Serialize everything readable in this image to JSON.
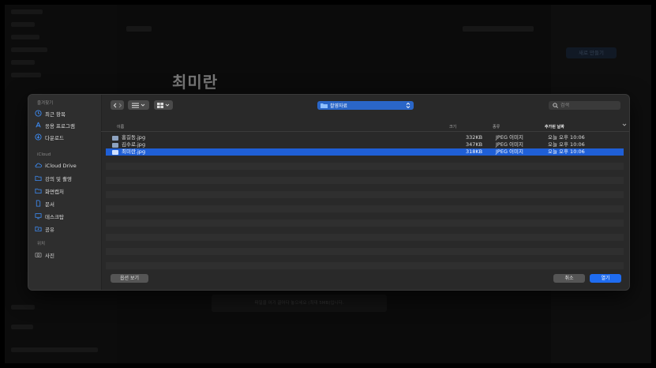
{
  "page": {
    "title": "최미란",
    "right_button": "새로 만들기",
    "upload_hint": "파일을 여기 끌어다 놓으세요 (최대 5MB)입니다.",
    "toolbar_right": [
      "공유"
    ]
  },
  "dialog": {
    "sidebar": {
      "favorites_label": "즐겨찾기",
      "favorites": [
        {
          "label": "최근 항목",
          "icon": "clock-icon"
        },
        {
          "label": "응용 프로그램",
          "icon": "apps-icon"
        },
        {
          "label": "다운로드",
          "icon": "download-icon"
        }
      ],
      "icloud_label": "iCloud",
      "icloud": [
        {
          "label": "iCloud Drive",
          "icon": "cloud-icon"
        },
        {
          "label": "강의 및 촬영",
          "icon": "folder-icon"
        },
        {
          "label": "화면캡처",
          "icon": "folder-icon"
        },
        {
          "label": "문서",
          "icon": "document-icon"
        },
        {
          "label": "데스크탑",
          "icon": "desktop-icon"
        },
        {
          "label": "공유",
          "icon": "shared-folder-icon"
        }
      ],
      "location_label": "위치",
      "location": [
        {
          "label": "사진",
          "icon": "camera-icon"
        }
      ]
    },
    "toolbar": {
      "current_folder": "촬영자료",
      "search_placeholder": "검색"
    },
    "columns": {
      "name": "이름",
      "size": "크기",
      "kind": "종류",
      "date_added": "추가된 날짜"
    },
    "files": [
      {
        "name": "홍길동.jpg",
        "size": "332KB",
        "kind": "JPEG 이미지",
        "date": "오늘 오후 10:06",
        "selected": false
      },
      {
        "name": "김수로.jpg",
        "size": "347KB",
        "kind": "JPEG 이미지",
        "date": "오늘 오후 10:06",
        "selected": false
      },
      {
        "name": "최미란.jpg",
        "size": "318KB",
        "kind": "JPEG 이미지",
        "date": "오늘 오후 10:06",
        "selected": true
      }
    ],
    "footer": {
      "options_label": "옵션 보기",
      "cancel_label": "취소",
      "open_label": "열기"
    },
    "colors": {
      "accent": "#1f5fd6",
      "dialog_bg": "#292929",
      "sidebar_bg": "#2e2e2e"
    }
  }
}
